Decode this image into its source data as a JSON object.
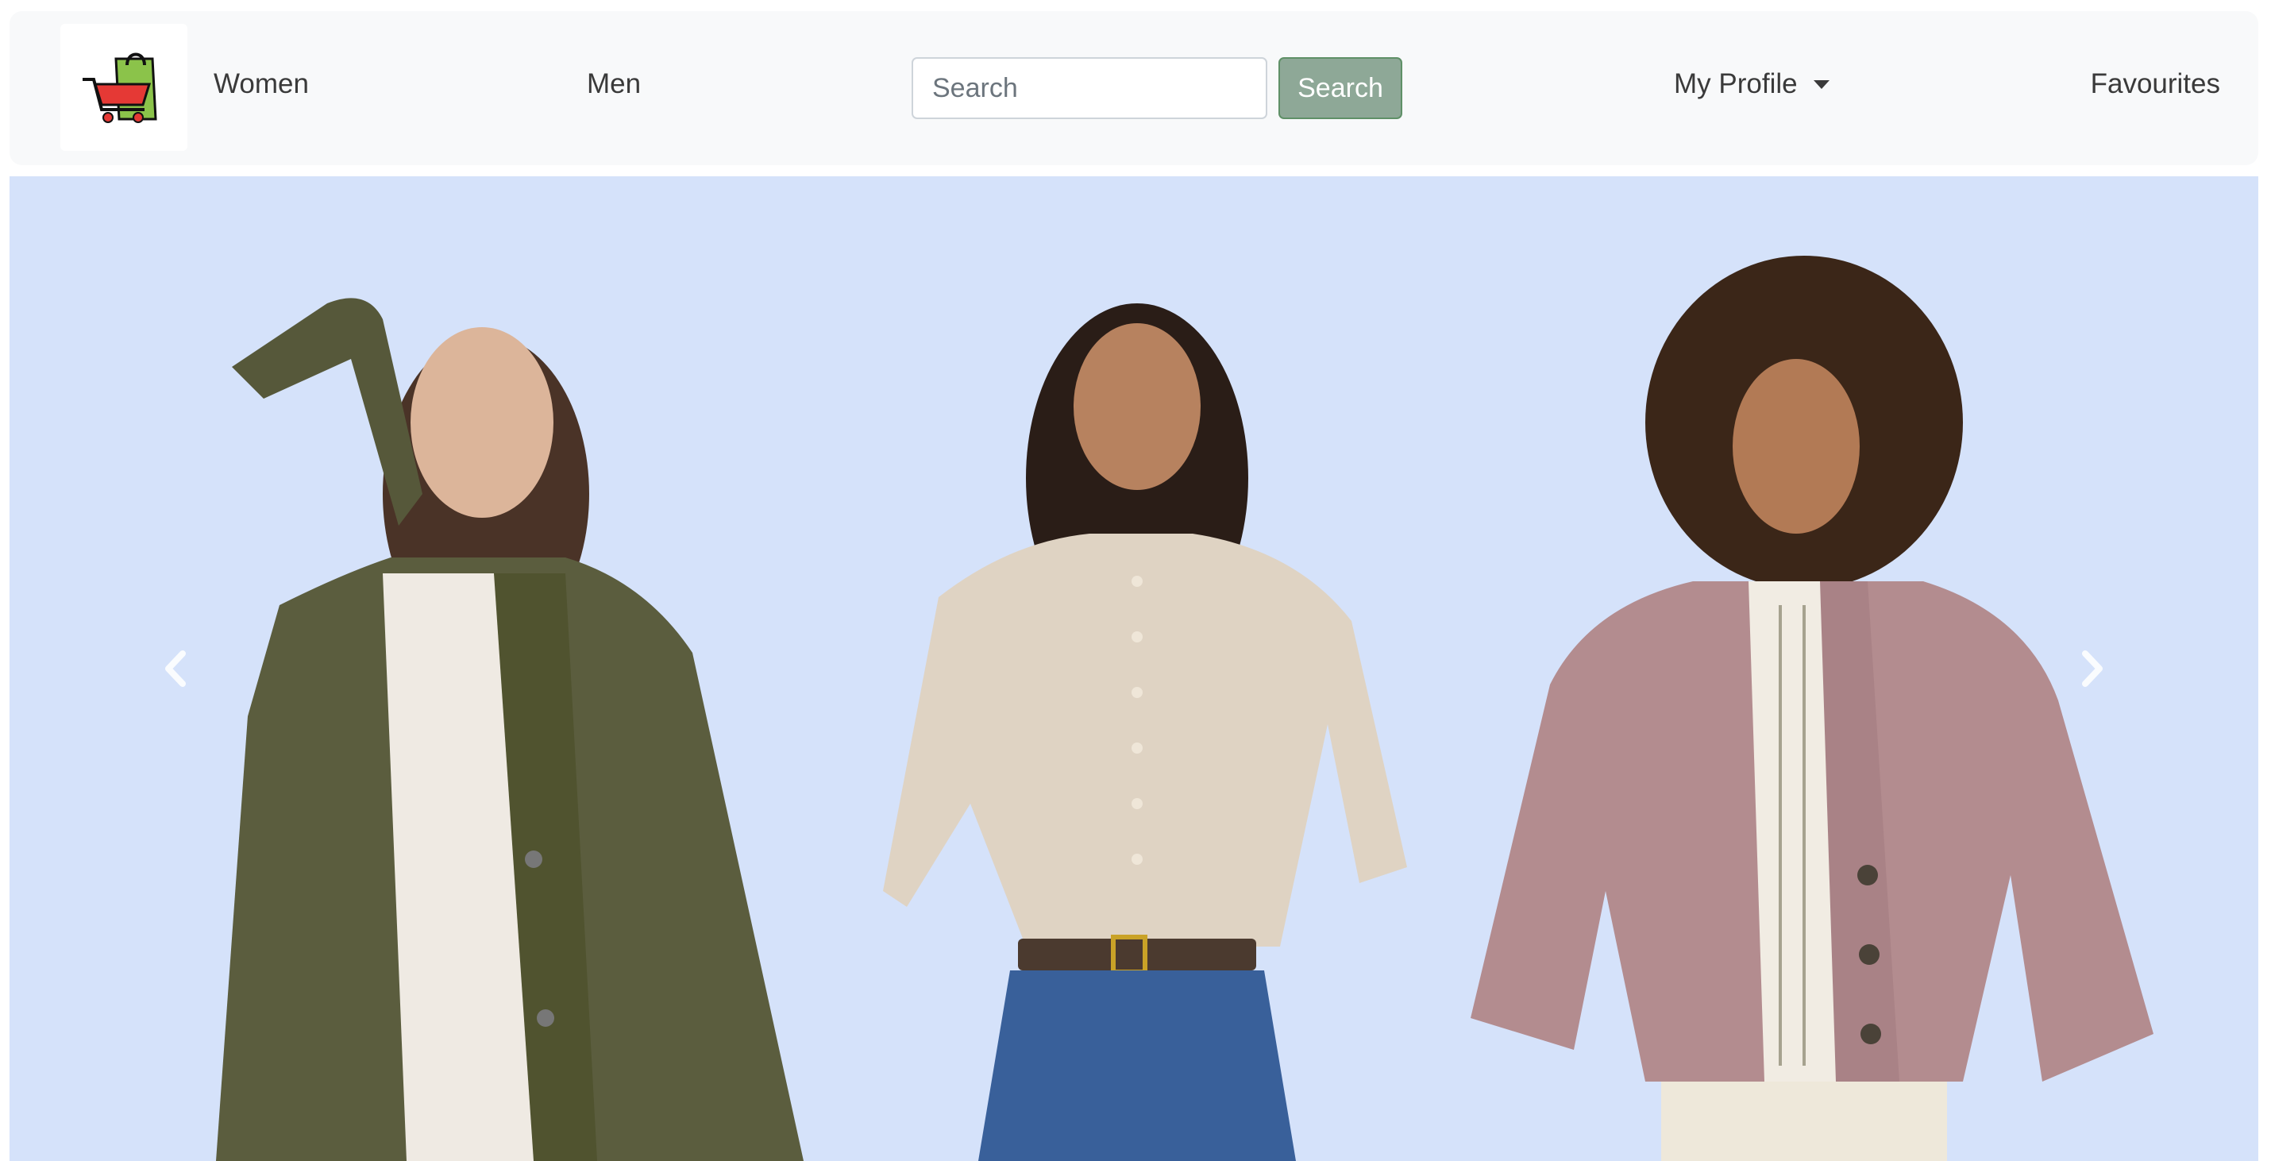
{
  "navbar": {
    "logo_icon": "shopping-cart-bag-icon",
    "women_label": "Women",
    "men_label": "Men",
    "search": {
      "placeholder": "Search",
      "value": ""
    },
    "search_button_label": "Search",
    "profile_label": "My Profile",
    "favourites_label": "Favourites"
  },
  "carousel": {
    "background": "#d5e2fa",
    "prev_icon": "chevron-left-icon",
    "next_icon": "chevron-right-icon",
    "slides": [
      {
        "figure": "woman-olive-cardigan",
        "color": "#5b5d3e"
      },
      {
        "figure": "woman-beige-cardigan",
        "color": "#dfd3c3"
      },
      {
        "figure": "woman-mauve-cardigan",
        "color": "#b38c8f"
      }
    ]
  },
  "colors": {
    "navbar_bg": "#f8f9fa",
    "search_button_bg": "#8ea897",
    "search_button_border": "#5f9067",
    "text": "#3a3a3a"
  }
}
